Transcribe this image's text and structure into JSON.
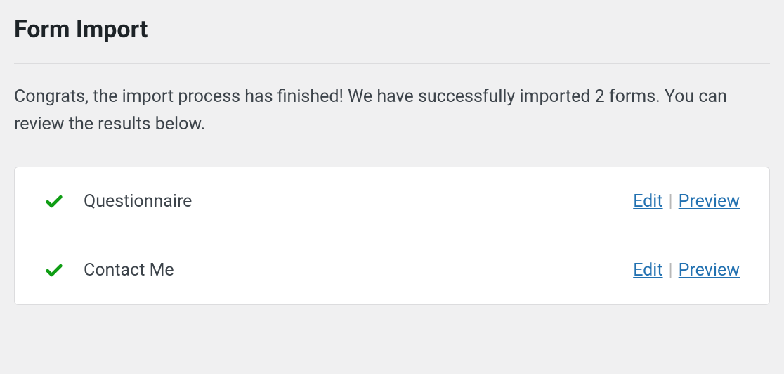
{
  "page": {
    "title": "Form Import"
  },
  "message": {
    "text": "Congrats, the import process has finished! We have successfully imported 2 forms. You can review the results below."
  },
  "labels": {
    "edit": "Edit",
    "preview": "Preview",
    "separator": "|"
  },
  "results": [
    {
      "name": "Questionnaire"
    },
    {
      "name": "Contact Me"
    }
  ]
}
